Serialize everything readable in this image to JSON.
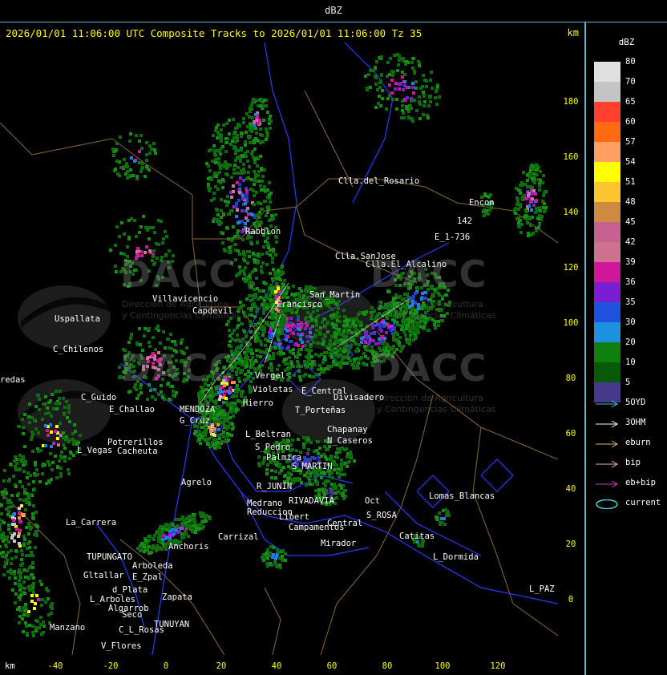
{
  "window": {
    "title": "dBZ"
  },
  "header": {
    "title": "2026/01/01 11:06:00 UTC Composite Tracks to 2026/01/01 11:06:00 Tz 35",
    "unit": "km"
  },
  "bottom_axis": {
    "unit": "km",
    "ticks": [
      "-40",
      "-20",
      "0",
      "20",
      "40",
      "60",
      "80",
      "100",
      "120"
    ]
  },
  "right_axis": {
    "ticks": [
      "180",
      "160",
      "140",
      "120",
      "100",
      "80",
      "60",
      "40",
      "20",
      "0"
    ]
  },
  "legend": {
    "unit": "dBZ",
    "scale": [
      {
        "label": "80",
        "color": "#e0e0e0"
      },
      {
        "label": "70",
        "color": "#c4c4c4"
      },
      {
        "label": "65",
        "color": "#ff4030"
      },
      {
        "label": "60",
        "color": "#ff6a10"
      },
      {
        "label": "57",
        "color": "#ffa060"
      },
      {
        "label": "54",
        "color": "#ffff00"
      },
      {
        "label": "51",
        "color": "#ffc530"
      },
      {
        "label": "48",
        "color": "#d08a40"
      },
      {
        "label": "45",
        "color": "#c86090"
      },
      {
        "label": "42",
        "color": "#d07090"
      },
      {
        "label": "39",
        "color": "#d0179a"
      },
      {
        "label": "36",
        "color": "#7a1fd0"
      },
      {
        "label": "35",
        "color": "#2050e0"
      },
      {
        "label": "30",
        "color": "#1e90e0"
      },
      {
        "label": "20",
        "color": "#0f8010"
      },
      {
        "label": "10",
        "color": "#085a08"
      },
      {
        "label": "5",
        "color": "#453a8c"
      }
    ],
    "tracks": [
      {
        "label": "5OYD",
        "color": "#40c8d0"
      },
      {
        "label": "3OHM",
        "color": "#ffffff"
      },
      {
        "label": "eburn",
        "color": "#e0b070"
      },
      {
        "label": "bip",
        "color": "#f0b0c0"
      },
      {
        "label": "eb+bip",
        "color": "#d040c0"
      },
      {
        "label": "current",
        "color": "#40d8e0"
      }
    ]
  },
  "watermark": {
    "brand": "DACC",
    "line1": "Dirección de Agricultura",
    "line2": "y Contingencias Climáticas"
  },
  "places": [
    "Clla.del_Rosario",
    "Encon",
    "E_1-736",
    "Clla.SanJose",
    "Clla.El_Alcalino",
    "Rabblon",
    "Villavicencio",
    "Capdevil",
    "Uspallata",
    "C_Chilenos",
    "redas",
    "C_Guido",
    "E_Challao",
    "MENDOZA",
    "G_Cruz",
    "Vergel",
    "Violetas",
    "Hierro",
    "E_Central",
    "Divisadero",
    "T_Porteñas",
    "L_Beltran",
    "Chapanay",
    "N_Caseros",
    "S_Pedro",
    "Palmira",
    "S_MARTIN",
    "Potrerillos",
    "Cacheuta",
    "L_Vegas",
    "Agrelo",
    "R_JUNIN",
    "RIVADAVIA",
    "Medrano",
    "Reduccion",
    "Libert",
    "Campamentos",
    "Central",
    "S_ROSA",
    "Lomas_Blancas",
    "Catitas",
    "La_Carrera",
    "Carrizal",
    "Anchoris",
    "TUPUNGATO",
    "Arboleda",
    "E_Zpal",
    "Gltallar",
    "d_Plata",
    "L_Arboles",
    "Zapata",
    "Algarrob",
    "Seco",
    "TUNUYAN",
    "C_L_Rosas",
    "Manzano",
    "V_Flores",
    "Mirador",
    "L_Dormida",
    "L_PAZ",
    "142",
    "Francisco",
    "San_Martin",
    "Oct"
  ]
}
